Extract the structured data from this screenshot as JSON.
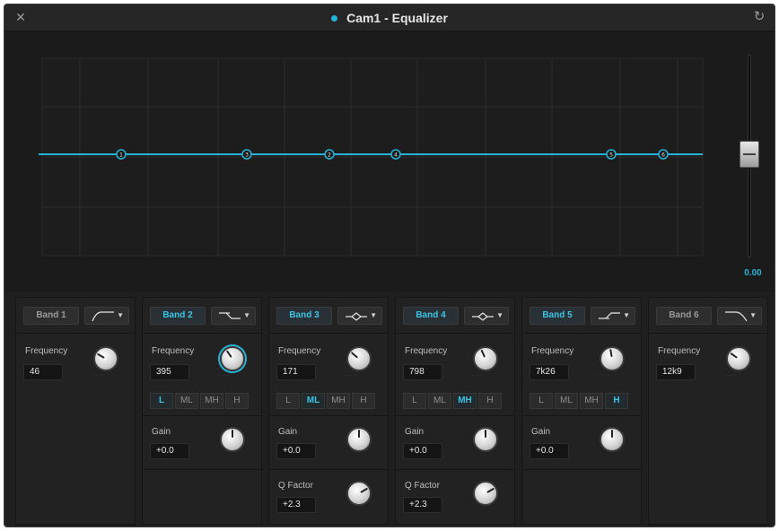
{
  "window": {
    "title": "Cam1 - Equalizer"
  },
  "fader": {
    "value": "0.00"
  },
  "graph": {
    "curve_color": "#27b3d6",
    "band_markers": [
      "1",
      "3",
      "2",
      "4",
      "5",
      "6"
    ]
  },
  "bands": [
    {
      "name": "Band 1",
      "active": false,
      "shape": "high-pass",
      "frequency": {
        "label": "Frequency",
        "value": "46"
      }
    },
    {
      "name": "Band 2",
      "active": true,
      "shape": "low-shelf",
      "frequency": {
        "label": "Frequency",
        "value": "395"
      },
      "range": {
        "options": [
          "L",
          "ML",
          "MH",
          "H"
        ],
        "selected": "L"
      },
      "gain": {
        "label": "Gain",
        "value": "+0.0"
      }
    },
    {
      "name": "Band 3",
      "active": true,
      "shape": "bell",
      "frequency": {
        "label": "Frequency",
        "value": "171"
      },
      "range": {
        "options": [
          "L",
          "ML",
          "MH",
          "H"
        ],
        "selected": "ML"
      },
      "gain": {
        "label": "Gain",
        "value": "+0.0"
      },
      "q": {
        "label": "Q Factor",
        "value": "+2.3"
      }
    },
    {
      "name": "Band 4",
      "active": true,
      "shape": "bell",
      "frequency": {
        "label": "Frequency",
        "value": "798"
      },
      "range": {
        "options": [
          "L",
          "ML",
          "MH",
          "H"
        ],
        "selected": "MH"
      },
      "gain": {
        "label": "Gain",
        "value": "+0.0"
      },
      "q": {
        "label": "Q Factor",
        "value": "+2.3"
      }
    },
    {
      "name": "Band 5",
      "active": true,
      "shape": "high-shelf",
      "frequency": {
        "label": "Frequency",
        "value": "7k26"
      },
      "range": {
        "options": [
          "L",
          "ML",
          "MH",
          "H"
        ],
        "selected": "H"
      },
      "gain": {
        "label": "Gain",
        "value": "+0.0"
      }
    },
    {
      "name": "Band 6",
      "active": false,
      "shape": "low-pass",
      "frequency": {
        "label": "Frequency",
        "value": "12k9"
      }
    }
  ]
}
